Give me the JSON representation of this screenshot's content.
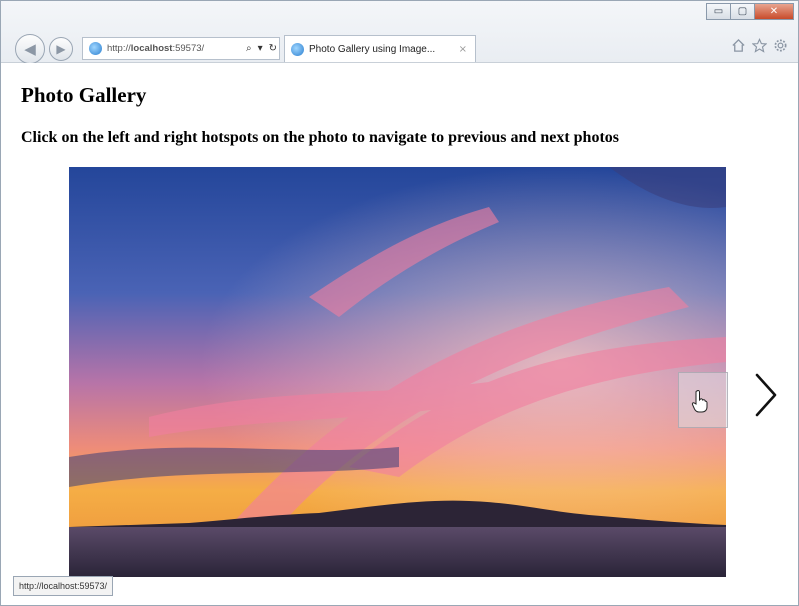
{
  "browser": {
    "address_url": "http://localhost:59573/",
    "address_shown_prefix": "http://",
    "address_shown_host": "localhost",
    "address_shown_rest": ":59573/",
    "tab_title": "Photo Gallery using Image...",
    "tab_close_glyph": "×",
    "search_glyph": "⌕",
    "dropdown_glyph": "▾",
    "refresh_glyph": "↻",
    "back_glyph": "◀",
    "forward_glyph": "▶",
    "minimize_glyph": "▭",
    "maximize_glyph": "▢",
    "close_glyph": "✕",
    "home_icon": "home-icon",
    "favorites_icon": "star-icon",
    "settings_icon": "gear-icon"
  },
  "page": {
    "title": "Photo Gallery",
    "instructions": "Click on the left and right hotspots on the photo to navigate to previous and next photos"
  },
  "status_bar": {
    "url": "http://localhost:59573/"
  },
  "colors": {
    "sky_top": "#2c4f9e",
    "sky_pink": "#e47a9a",
    "horizon_orange": "#f2a23c",
    "water": "#3a2f4a"
  }
}
